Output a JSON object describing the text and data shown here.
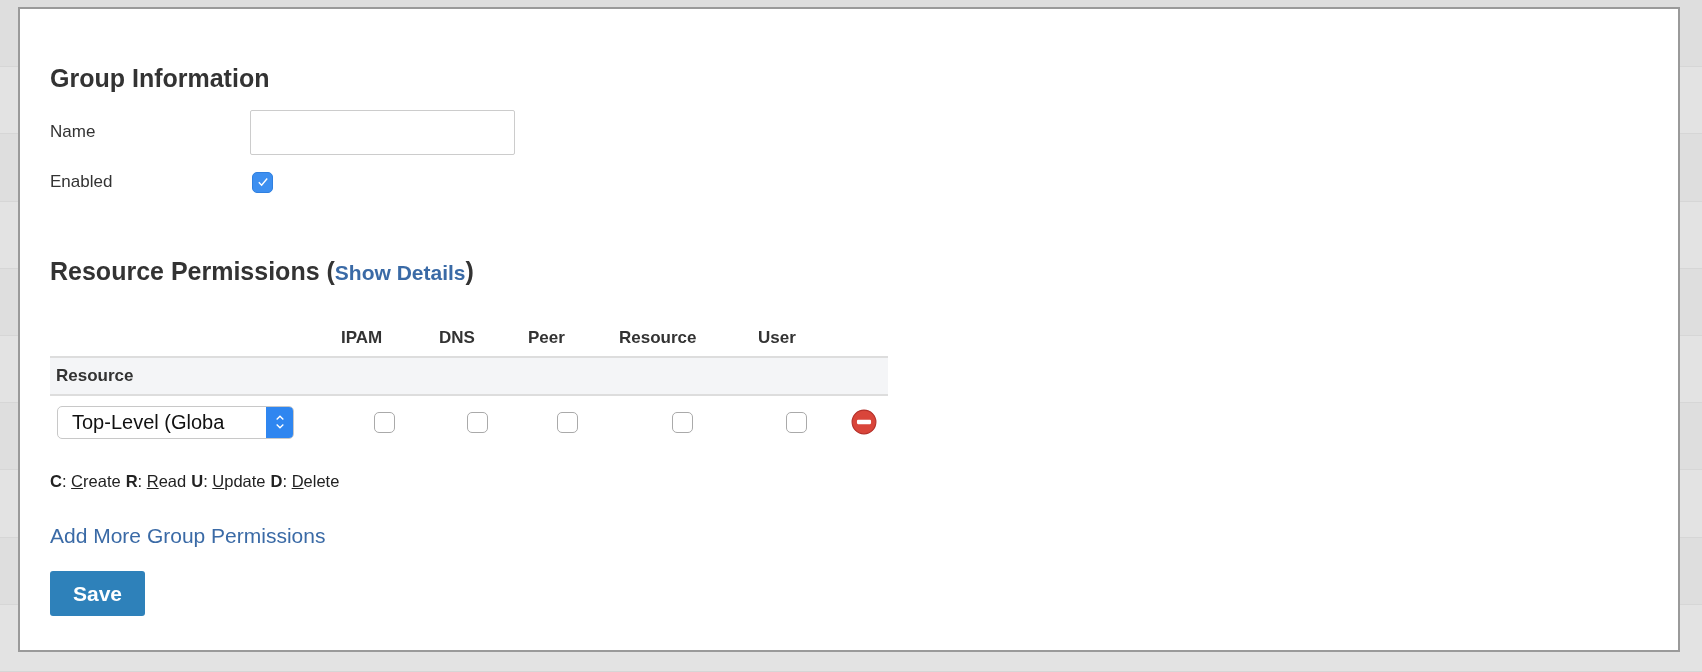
{
  "group_information": {
    "title": "Group Information",
    "fields": [
      {
        "kind": "text",
        "label": "Name"
      },
      {
        "kind": "checkbox",
        "label": "Enabled",
        "checked": true
      }
    ]
  },
  "resource_permissions": {
    "title": "Resource Permissions (",
    "details_link": "Show Details",
    "title_end": ")",
    "columns": [
      "IPAM",
      "DNS",
      "Peer",
      "Resource",
      "User"
    ],
    "resource_header": "Resource",
    "rows": [
      {
        "resource": "Top-Level (Globa",
        "checks": [
          false,
          false,
          false,
          false,
          false
        ]
      }
    ],
    "legend": [
      {
        "key": "**C**:",
        "label": "Create"
      },
      {
        "key": "**R**:",
        "label": "Read"
      },
      {
        "key": "**U**:",
        "label": "Update"
      },
      {
        "key": "**D**:",
        "label": "Delete"
      }
    ],
    "add_link": "Add More Group Permissions"
  },
  "save_button": "Save"
}
